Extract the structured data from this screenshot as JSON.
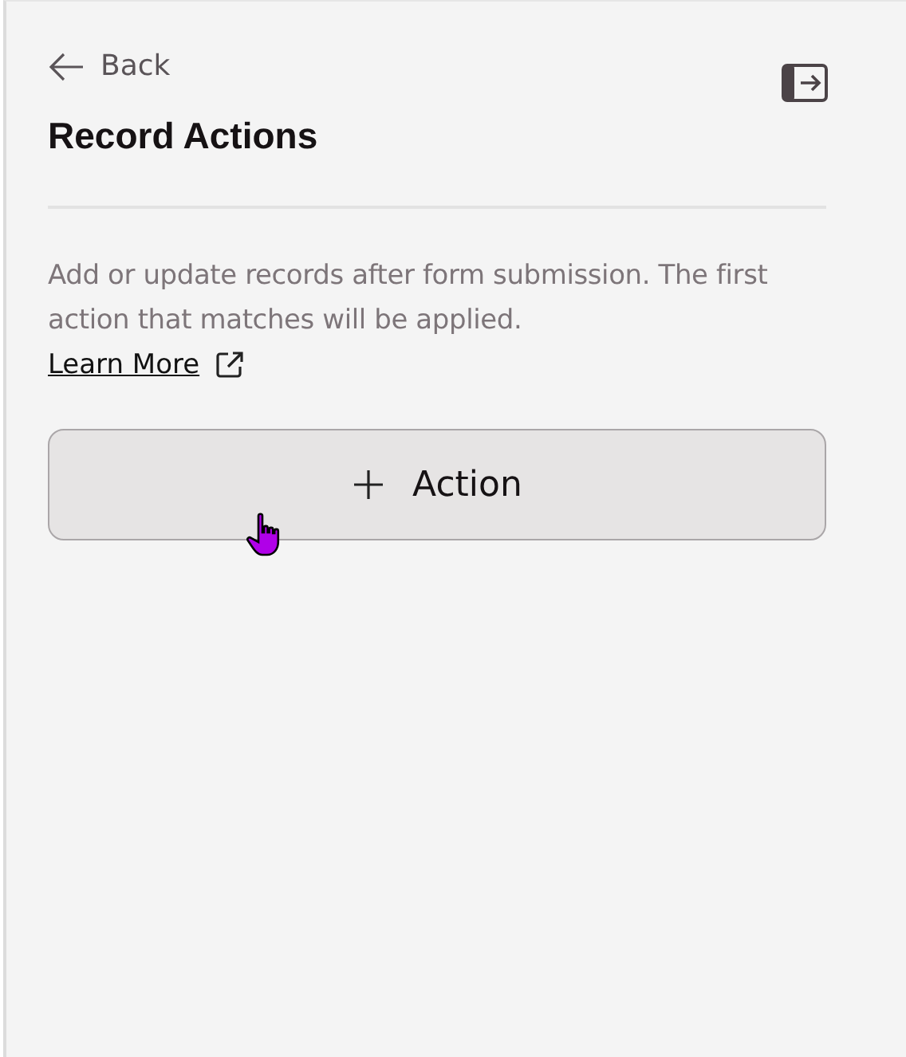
{
  "back": {
    "label": "Back"
  },
  "title": "Record Actions",
  "description": "Add or update records after form submission. The first action that matches will be applied.",
  "learn_more": {
    "label": "Learn More"
  },
  "add_button": {
    "label": "Action"
  }
}
